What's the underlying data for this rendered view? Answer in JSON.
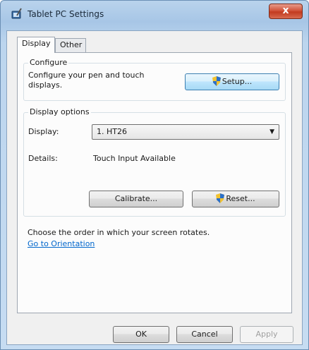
{
  "window": {
    "title": "Tablet PC Settings",
    "close_label": "x"
  },
  "tabs": [
    {
      "label": "Display",
      "active": true
    },
    {
      "label": "Other",
      "active": false
    }
  ],
  "configure": {
    "title": "Configure",
    "description": "Configure your pen and touch displays.",
    "setup_label": "Setup..."
  },
  "display_options": {
    "title": "Display options",
    "display_label": "Display:",
    "display_value": "1. HT26",
    "details_label": "Details:",
    "details_value": "Touch Input Available",
    "calibrate_label": "Calibrate...",
    "reset_label": "Reset..."
  },
  "orientation": {
    "text": "Choose the order in which your screen rotates.",
    "link": "Go to Orientation"
  },
  "footer": {
    "ok": "OK",
    "cancel": "Cancel",
    "apply": "Apply"
  },
  "colors": {
    "link": "#0066cc",
    "titlebar": "#a7c6e6",
    "close": "#c23a1f"
  },
  "icons": [
    "tablet-pen-icon",
    "uac-shield-icon"
  ]
}
